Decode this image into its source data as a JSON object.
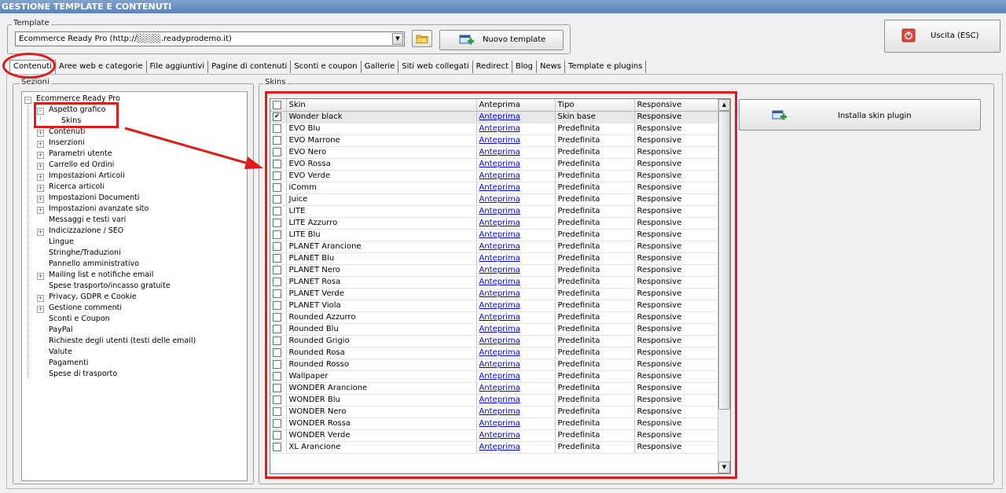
{
  "window": {
    "title": "GESTIONE TEMPLATE E CONTENUTI"
  },
  "template": {
    "group_label": "Template",
    "selected": "Ecommerce Ready Pro (http://░░░░.readyprodemo.it)",
    "new_button": "Nuovo template",
    "exit_button": "Uscita (ESC)"
  },
  "tabs": [
    {
      "label": "Contenuti",
      "active": true
    },
    {
      "label": "Aree web e categorie"
    },
    {
      "label": "File aggiuntivi"
    },
    {
      "label": "Pagine di contenuti"
    },
    {
      "label": "Sconti e coupon"
    },
    {
      "label": "Gallerie"
    },
    {
      "label": "Siti web collegati"
    },
    {
      "label": "Redirect"
    },
    {
      "label": "Blog"
    },
    {
      "label": "News"
    },
    {
      "label": "Template e plugins"
    }
  ],
  "sections": {
    "label": "Sezioni",
    "root": "Ecommerce Ready Pro",
    "aspetto": "Aspetto grafico",
    "skins": "Skins",
    "items": [
      {
        "label": "Contenuti",
        "expandable": true
      },
      {
        "label": "Inserzioni",
        "expandable": true
      },
      {
        "label": "Parametri utente",
        "expandable": true
      },
      {
        "label": "Carrello ed Ordini",
        "expandable": true
      },
      {
        "label": "Impostazioni Articoli",
        "expandable": true
      },
      {
        "label": "Ricerca articoli",
        "expandable": true
      },
      {
        "label": "Impostazioni Documenti",
        "expandable": true
      },
      {
        "label": "Impostazioni avanzate sito",
        "expandable": true
      },
      {
        "label": "Messaggi e testi vari",
        "expandable": false
      },
      {
        "label": "Indicizzazione / SEO",
        "expandable": true
      },
      {
        "label": "Lingue",
        "expandable": false
      },
      {
        "label": "Stringhe/Traduzioni",
        "expandable": false
      },
      {
        "label": "Pannello amministrativo",
        "expandable": false
      },
      {
        "label": "Mailing list e notifiche email",
        "expandable": true
      },
      {
        "label": "Spese trasporto/incasso gratuite",
        "expandable": false
      },
      {
        "label": "Privacy, GDPR e Cookie",
        "expandable": true
      },
      {
        "label": "Gestione commenti",
        "expandable": true
      },
      {
        "label": "Sconti e Coupon",
        "expandable": false
      },
      {
        "label": "PayPal",
        "expandable": false
      },
      {
        "label": "Richieste degli utenti (testi delle email)",
        "expandable": false
      },
      {
        "label": "Valute",
        "expandable": false
      },
      {
        "label": "Pagamenti",
        "expandable": false
      },
      {
        "label": "Spese di trasporto",
        "expandable": false
      }
    ]
  },
  "skins": {
    "label": "Skins",
    "install_button": "Installa skin plugin",
    "columns": [
      "Skin",
      "Anteprima",
      "Tipo",
      "Responsive"
    ],
    "rows": [
      {
        "name": "Wonder black",
        "preview": "Anteprima",
        "type": "Skin base",
        "responsive": "Responsive",
        "checked": true
      },
      {
        "name": "EVO Blu",
        "preview": "Anteprima",
        "type": "Predefinita",
        "responsive": "Responsive"
      },
      {
        "name": "EVO Marrone",
        "preview": "Anteprima",
        "type": "Predefinita",
        "responsive": "Responsive"
      },
      {
        "name": "EVO Nero",
        "preview": "Anteprima",
        "type": "Predefinita",
        "responsive": "Responsive"
      },
      {
        "name": "EVO Rossa",
        "preview": "Anteprima",
        "type": "Predefinita",
        "responsive": "Responsive"
      },
      {
        "name": "EVO Verde",
        "preview": "Anteprima",
        "type": "Predefinita",
        "responsive": "Responsive"
      },
      {
        "name": "iComm",
        "preview": "Anteprima",
        "type": "Predefinita",
        "responsive": "Responsive"
      },
      {
        "name": "Juice",
        "preview": "Anteprima",
        "type": "Predefinita",
        "responsive": "Responsive"
      },
      {
        "name": "LITE",
        "preview": "Anteprima",
        "type": "Predefinita",
        "responsive": "Responsive"
      },
      {
        "name": "LITE Azzurro",
        "preview": "Anteprima",
        "type": "Predefinita",
        "responsive": "Responsive"
      },
      {
        "name": "LITE Blu",
        "preview": "Anteprima",
        "type": "Predefinita",
        "responsive": "Responsive"
      },
      {
        "name": "PLANET Arancione",
        "preview": "Anteprima",
        "type": "Predefinita",
        "responsive": "Responsive"
      },
      {
        "name": "PLANET Blu",
        "preview": "Anteprima",
        "type": "Predefinita",
        "responsive": "Responsive"
      },
      {
        "name": "PLANET Nero",
        "preview": "Anteprima",
        "type": "Predefinita",
        "responsive": "Responsive"
      },
      {
        "name": "PLANET Rosa",
        "preview": "Anteprima",
        "type": "Predefinita",
        "responsive": "Responsive"
      },
      {
        "name": "PLANET Verde",
        "preview": "Anteprima",
        "type": "Predefinita",
        "responsive": "Responsive"
      },
      {
        "name": "PLANET Viola",
        "preview": "Anteprima",
        "type": "Predefinita",
        "responsive": "Responsive"
      },
      {
        "name": "Rounded Azzurro",
        "preview": "Anteprima",
        "type": "Predefinita",
        "responsive": "Responsive"
      },
      {
        "name": "Rounded Blu",
        "preview": "Anteprima",
        "type": "Predefinita",
        "responsive": "Responsive"
      },
      {
        "name": "Rounded Grigio",
        "preview": "Anteprima",
        "type": "Predefinita",
        "responsive": "Responsive"
      },
      {
        "name": "Rounded Rosa",
        "preview": "Anteprima",
        "type": "Predefinita",
        "responsive": "Responsive"
      },
      {
        "name": "Rounded Rosso",
        "preview": "Anteprima",
        "type": "Predefinita",
        "responsive": "Responsive"
      },
      {
        "name": "Wallpaper",
        "preview": "Anteprima",
        "type": "Predefinita",
        "responsive": "Responsive"
      },
      {
        "name": "WONDER Arancione",
        "preview": "Anteprima",
        "type": "Predefinita",
        "responsive": "Responsive"
      },
      {
        "name": "WONDER Blu",
        "preview": "Anteprima",
        "type": "Predefinita",
        "responsive": "Responsive"
      },
      {
        "name": "WONDER Nero",
        "preview": "Anteprima",
        "type": "Predefinita",
        "responsive": "Responsive"
      },
      {
        "name": "WONDER Rossa",
        "preview": "Anteprima",
        "type": "Predefinita",
        "responsive": "Responsive"
      },
      {
        "name": "WONDER Verde",
        "preview": "Anteprima",
        "type": "Predefinita",
        "responsive": "Responsive"
      },
      {
        "name": "XL Arancione",
        "preview": "Anteprima",
        "type": "Predefinita",
        "responsive": "Responsive"
      }
    ]
  },
  "colors": {
    "annotation_red": "#e01b1b",
    "link_blue": "#0000ee",
    "titlebar": "#5b83b8"
  }
}
